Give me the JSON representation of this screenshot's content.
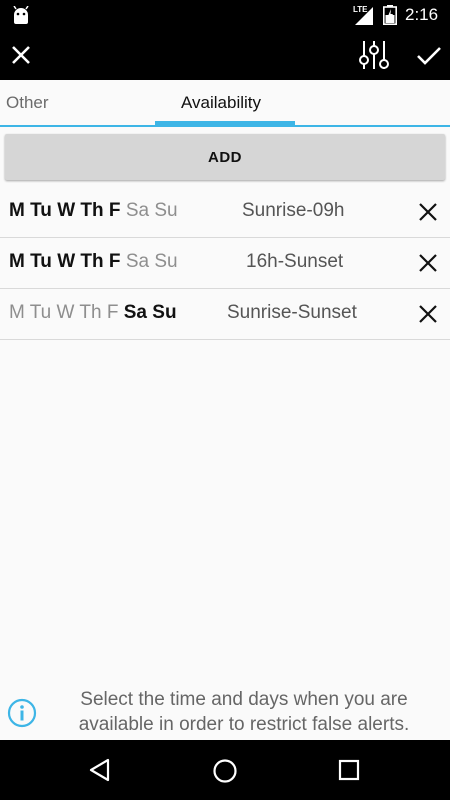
{
  "status_bar": {
    "time": "2:16",
    "network": "LTE",
    "icons": [
      "android-icon",
      "signal-icon",
      "battery-icon"
    ]
  },
  "app_bar": {
    "icons": [
      "close-icon",
      "equalizer-icon",
      "check-icon"
    ]
  },
  "tabs": [
    {
      "label": "Other",
      "selected": false
    },
    {
      "label": "Availability",
      "selected": true
    }
  ],
  "accent_color": "#3db5e6",
  "add_button": {
    "label": "ADD"
  },
  "schedules": [
    {
      "days": [
        {
          "label": "M",
          "active": true
        },
        {
          "label": "Tu",
          "active": true
        },
        {
          "label": "W",
          "active": true
        },
        {
          "label": "Th",
          "active": true
        },
        {
          "label": "F",
          "active": true
        },
        {
          "label": "Sa",
          "active": false
        },
        {
          "label": "Su",
          "active": false
        }
      ],
      "time": "Sunrise-09h"
    },
    {
      "days": [
        {
          "label": "M",
          "active": true
        },
        {
          "label": "Tu",
          "active": true
        },
        {
          "label": "W",
          "active": true
        },
        {
          "label": "Th",
          "active": true
        },
        {
          "label": "F",
          "active": true
        },
        {
          "label": "Sa",
          "active": false
        },
        {
          "label": "Su",
          "active": false
        }
      ],
      "time": "16h-Sunset"
    },
    {
      "days": [
        {
          "label": "M",
          "active": false
        },
        {
          "label": "Tu",
          "active": false
        },
        {
          "label": "W",
          "active": false
        },
        {
          "label": "Th",
          "active": false
        },
        {
          "label": "F",
          "active": false
        },
        {
          "label": "Sa",
          "active": true
        },
        {
          "label": "Su",
          "active": true
        }
      ],
      "time": "Sunrise-Sunset"
    }
  ],
  "hint": {
    "icon": "info-icon",
    "text_line1": "Select the time and days when you are",
    "text_line2": "available in order to restrict false alerts."
  },
  "nav_bar": {
    "icons": [
      "back-icon",
      "home-icon",
      "recents-icon"
    ]
  }
}
